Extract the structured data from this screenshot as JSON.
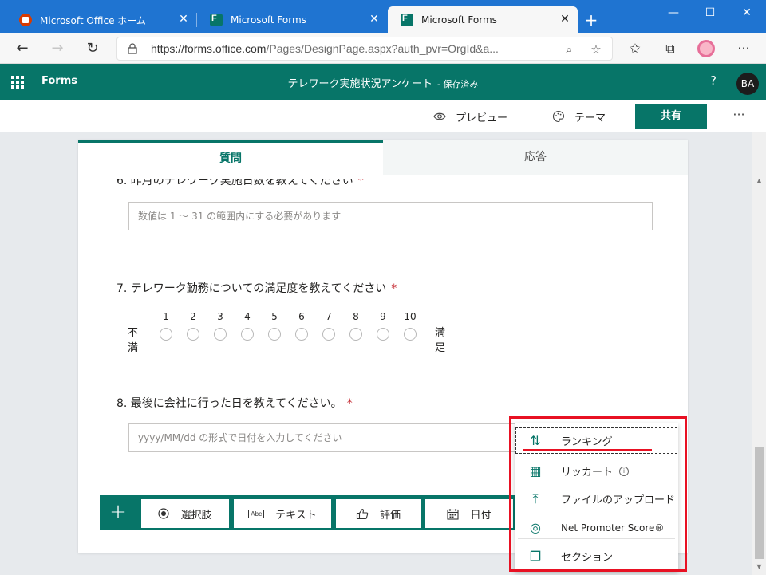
{
  "browser": {
    "tabs": [
      {
        "title": "Microsoft Office ホーム",
        "favicon": "office-icon",
        "active": false
      },
      {
        "title": "Microsoft Forms",
        "favicon": "forms-icon",
        "active": false
      },
      {
        "title": "Microsoft Forms",
        "favicon": "forms-icon",
        "active": true
      }
    ],
    "tab_close_glyph": "✕",
    "new_tab_glyph": "+",
    "window_controls": {
      "minimize": "—",
      "maximize": "☐",
      "close": "✕"
    },
    "address_url_main": "https://forms.office.com",
    "address_url_rest": "/Pages/DesignPage.aspx?auth_pvr=OrgId&a...",
    "colors": {
      "tabstrip": "#1f74d1",
      "accent": "#077568"
    }
  },
  "app": {
    "brand": "Forms",
    "form_title": "テレワーク実施状況アンケート",
    "save_status": "- 保存済み",
    "help_glyph": "?",
    "user_initials": "BA"
  },
  "commandbar": {
    "preview_label": "プレビュー",
    "theme_label": "テーマ",
    "share_label": "共有",
    "more_glyph": "···"
  },
  "designer": {
    "tabs": {
      "questions": "質問",
      "responses": "応答"
    },
    "q6": {
      "text": "6. 昨月のテレワーク実施日数を教えてください",
      "required": "*",
      "placeholder": "数値は 1 ～ 31 の範囲内にする必要があります"
    },
    "q7": {
      "text": "7. テレワーク勤務についての満足度を教えてください",
      "required": "*",
      "low_label": "不満",
      "high_label": "満足",
      "scale": [
        "1",
        "2",
        "3",
        "4",
        "5",
        "6",
        "7",
        "8",
        "9",
        "10"
      ]
    },
    "q8": {
      "text": "8. 最後に会社に行った日を教えてください。",
      "required": "*",
      "placeholder": "yyyy/MM/dd の形式で日付を入力してください"
    }
  },
  "addbar": {
    "plus_glyph": "+",
    "choice_label": "選択肢",
    "text_label": "テキスト",
    "text_icon_label": "Abc",
    "rating_label": "評価",
    "date_label": "日付"
  },
  "menu": {
    "items": [
      {
        "label": "ランキング",
        "icon": "ranking-icon",
        "glyph": "⇅"
      },
      {
        "label": "リッカート",
        "icon": "likert-icon",
        "glyph": "▦",
        "info": "i"
      },
      {
        "label": "ファイルのアップロード",
        "icon": "upload-icon",
        "glyph": "⤒"
      },
      {
        "label": "Net Promoter Score®",
        "icon": "nps-icon",
        "glyph": "◎"
      },
      {
        "label": "セクション",
        "icon": "section-icon",
        "glyph": "❐"
      }
    ]
  }
}
